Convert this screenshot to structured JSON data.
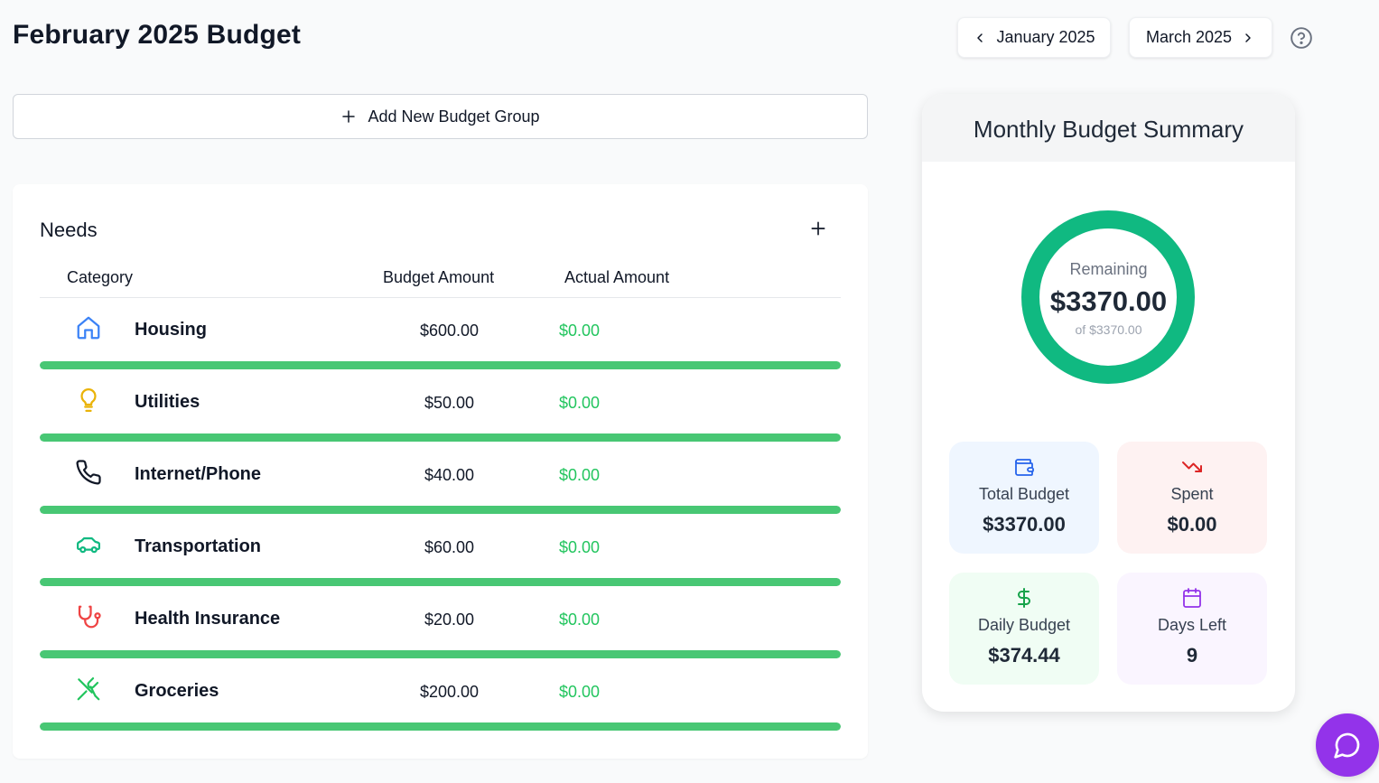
{
  "page": {
    "title": "February 2025 Budget"
  },
  "nav": {
    "prev_label": "January 2025",
    "next_label": "March 2025"
  },
  "add_group_label": "Add New Budget Group",
  "group": {
    "title": "Needs",
    "headers": {
      "category": "Category",
      "budget": "Budget Amount",
      "actual": "Actual Amount"
    },
    "rows": [
      {
        "name": "Housing",
        "budget": "$600.00",
        "actual": "$0.00",
        "icon": "home-icon",
        "icon_color": "#3b82f6",
        "remaining_fraction": 1.0
      },
      {
        "name": "Utilities",
        "budget": "$50.00",
        "actual": "$0.00",
        "icon": "lightbulb-icon",
        "icon_color": "#eab308",
        "remaining_fraction": 1.0
      },
      {
        "name": "Internet/Phone",
        "budget": "$40.00",
        "actual": "$0.00",
        "icon": "phone-icon",
        "icon_color": "#111827",
        "remaining_fraction": 1.0
      },
      {
        "name": "Transportation",
        "budget": "$60.00",
        "actual": "$0.00",
        "icon": "car-icon",
        "icon_color": "#10b981",
        "remaining_fraction": 1.0
      },
      {
        "name": "Health Insurance",
        "budget": "$20.00",
        "actual": "$0.00",
        "icon": "stethoscope-icon",
        "icon_color": "#ef4444",
        "remaining_fraction": 1.0
      },
      {
        "name": "Groceries",
        "budget": "$200.00",
        "actual": "$0.00",
        "icon": "utensils-icon",
        "icon_color": "#22c55e",
        "remaining_fraction": 1.0
      }
    ]
  },
  "summary": {
    "title": "Monthly Budget Summary",
    "remaining_label": "Remaining",
    "remaining_value": "$3370.00",
    "remaining_of": "of $3370.00",
    "remaining_fraction": 1.0,
    "ring_color": "#10b981",
    "stats": {
      "total": {
        "label": "Total Budget",
        "value": "$3370.00",
        "icon": "wallet-icon",
        "color": "#2563eb"
      },
      "spent": {
        "label": "Spent",
        "value": "$0.00",
        "icon": "trending-down-icon",
        "color": "#dc2626"
      },
      "daily": {
        "label": "Daily Budget",
        "value": "$374.44",
        "icon": "dollar-icon",
        "color": "#16a34a"
      },
      "days": {
        "label": "Days Left",
        "value": "9",
        "icon": "calendar-icon",
        "color": "#9333ea"
      }
    }
  },
  "colors": {
    "progress": "#48c774",
    "actual_text": "#22c55e",
    "chat_button": "#9333ea"
  },
  "icons": {
    "help": "help-circle-icon",
    "chat": "message-circle-icon",
    "prev": "chevron-left-icon",
    "next": "chevron-right-icon",
    "add": "plus-icon"
  }
}
